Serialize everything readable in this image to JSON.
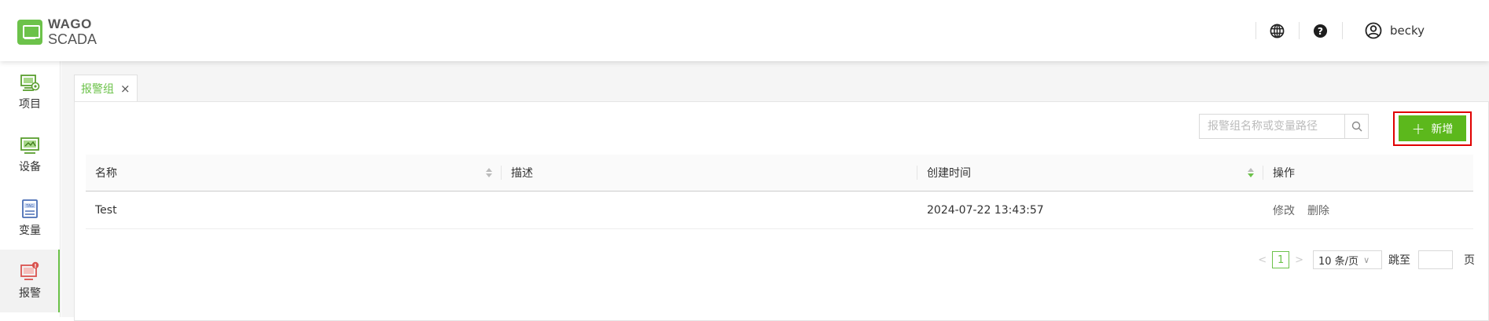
{
  "brand": {
    "line1": "WAGO",
    "line2": "SCADA",
    "accent": "#6cc24a"
  },
  "header": {
    "user_name": "becky",
    "icons": [
      "globe-icon",
      "help-icon",
      "user-icon"
    ]
  },
  "sidebar": {
    "items": [
      {
        "label": "项目",
        "icon": "project-icon"
      },
      {
        "label": "设备",
        "icon": "device-icon"
      },
      {
        "label": "变量",
        "icon": "tag-icon"
      },
      {
        "label": "报警",
        "icon": "alarm-icon",
        "active": true
      }
    ]
  },
  "tabs": [
    {
      "label": "报警组",
      "close": "×"
    }
  ],
  "toolbar": {
    "search_placeholder": "报警组名称或变量路径",
    "add_label": "新增"
  },
  "table": {
    "columns": [
      "名称",
      "描述",
      "创建时间",
      "操作"
    ],
    "rows": [
      {
        "name": "Test",
        "description": "",
        "created": "2024-07-22 13:43:57",
        "actions": [
          "修改",
          "删除"
        ]
      }
    ]
  },
  "pagination": {
    "current": "1",
    "page_size": "10 条/页",
    "jump_label": "跳至",
    "page_suffix": "页"
  }
}
